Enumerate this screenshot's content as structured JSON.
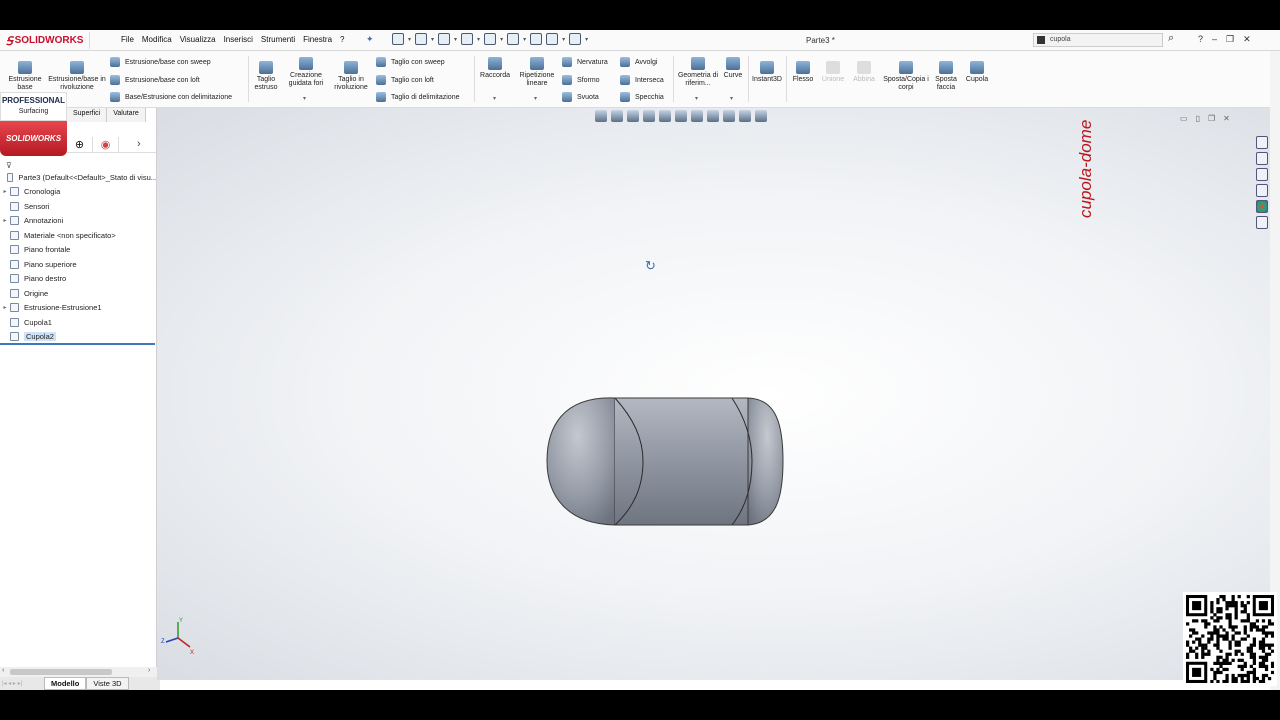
{
  "app": {
    "brand": "SOLIDWORKS",
    "doc_title": "Parte3 *"
  },
  "menu": [
    "File",
    "Modifica",
    "Visualizza",
    "Inserisci",
    "Strumenti",
    "Finestra",
    "?"
  ],
  "search": {
    "value": "cupola"
  },
  "ribbon": {
    "estrusione_base": "Estrusione base",
    "estrusione_rivoluzione": "Estrusione/base in rivoluzione",
    "sweep": "Estrusione/base con sweep",
    "loft": "Estrusione/base con loft",
    "delimitazione": "Base/Estrusione con delimitazione",
    "taglio_estruso": "Taglio estruso",
    "creazione_fori": "Creazione guidata fori",
    "taglio_rivoluzione": "Taglio in rivoluzione",
    "taglio_sweep": "Taglio con sweep",
    "taglio_loft": "Taglio con loft",
    "taglio_delimitazione": "Taglio di delimitazione",
    "raccorda": "Raccorda",
    "ripetizione": "Ripetizione lineare",
    "nervatura": "Nervatura",
    "sformo": "Sformo",
    "svuota": "Svuota",
    "avvolgi": "Avvolgi",
    "interseca": "Interseca",
    "specchia": "Specchia",
    "geometria": "Geometria di riferim...",
    "curve": "Curve",
    "instant3d": "Instant3D",
    "flesso": "Flesso",
    "unione": "Unione",
    "abbina": "Abbina",
    "sposta_copia": "Sposta/Copia i corpi",
    "sposta_faccia": "Sposta faccia",
    "cupola": "Cupola"
  },
  "badge": {
    "edition": "PROFESSIONAL",
    "package": "Surfacing",
    "brand": "SOLIDWORKS"
  },
  "tabs": [
    "Superfici",
    "Valutare"
  ],
  "tree": [
    {
      "label": "Parte3  (Default<<Default>_Stato di visu...",
      "expand": "",
      "sel": false
    },
    {
      "label": "Cronologia",
      "expand": "▸",
      "sel": false
    },
    {
      "label": "Sensori",
      "expand": "",
      "sel": false
    },
    {
      "label": "Annotazioni",
      "expand": "▸",
      "sel": false
    },
    {
      "label": "Materiale <non specificato>",
      "expand": "",
      "sel": false
    },
    {
      "label": "Piano frontale",
      "expand": "",
      "sel": false
    },
    {
      "label": "Piano superiore",
      "expand": "",
      "sel": false
    },
    {
      "label": "Piano destro",
      "expand": "",
      "sel": false
    },
    {
      "label": "Origine",
      "expand": "",
      "sel": false
    },
    {
      "label": "Estrusione-Estrusione1",
      "expand": "▸",
      "sel": false
    },
    {
      "label": "Cupola1",
      "expand": "",
      "sel": false
    },
    {
      "label": "Cupola2",
      "expand": "",
      "sel": true
    }
  ],
  "bottom_tabs": {
    "modello": "Modello",
    "viste3d": "Viste 3D"
  },
  "watermark": "cupola-dome",
  "triad": {
    "x": "X",
    "y": "Y",
    "z": "Z"
  },
  "colors": {
    "brand_red": "#c8102e",
    "accent_blue": "#3a78c0",
    "model_gray": "#9aa0ab"
  }
}
